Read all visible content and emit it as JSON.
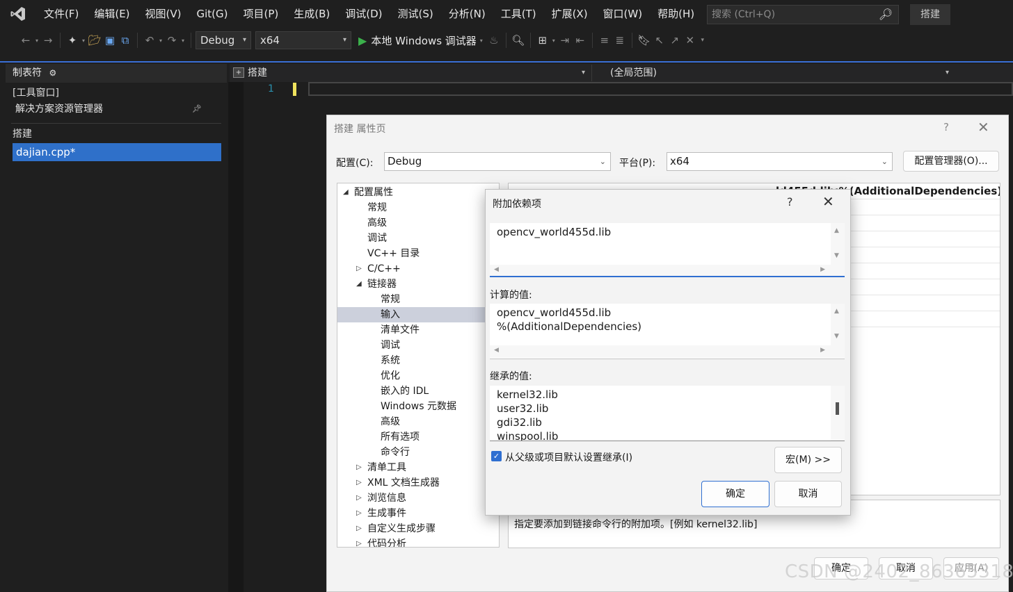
{
  "menubar": {
    "items": [
      "文件(F)",
      "编辑(E)",
      "视图(V)",
      "Git(G)",
      "项目(P)",
      "生成(B)",
      "调试(D)",
      "测试(S)",
      "分析(N)",
      "工具(T)",
      "扩展(X)",
      "窗口(W)",
      "帮助(H)"
    ],
    "search_placeholder": "搜索 (Ctrl+Q)",
    "solution_name": "搭建"
  },
  "toolbar": {
    "config": "Debug",
    "platform": "x64",
    "run_label": "本地 Windows 调试器"
  },
  "left_panel": {
    "title": "制表符",
    "group_label": "[工具窗口]",
    "solution_explorer": "解决方案资源管理器",
    "project_label": "搭建",
    "open_file": "dajian.cpp*"
  },
  "editor": {
    "file_scope": "搭建",
    "scope": "(全局范围)",
    "line_number": "1"
  },
  "prop_dialog": {
    "title": "搭建 属性页",
    "help": "?",
    "config_label": "配置(C):",
    "config_value": "Debug",
    "platform_label": "平台(P):",
    "platform_value": "x64",
    "config_manager": "配置管理器(O)...",
    "tree": [
      {
        "label": "配置属性",
        "level": 0,
        "expander": "◢"
      },
      {
        "label": "常规",
        "level": 1,
        "expander": ""
      },
      {
        "label": "高级",
        "level": 1,
        "expander": ""
      },
      {
        "label": "调试",
        "level": 1,
        "expander": ""
      },
      {
        "label": "VC++ 目录",
        "level": 1,
        "expander": ""
      },
      {
        "label": "C/C++",
        "level": 1,
        "expander": "▷"
      },
      {
        "label": "链接器",
        "level": 1,
        "expander": "◢"
      },
      {
        "label": "常规",
        "level": 2,
        "expander": ""
      },
      {
        "label": "输入",
        "level": 2,
        "expander": "",
        "selected": true
      },
      {
        "label": "清单文件",
        "level": 2,
        "expander": ""
      },
      {
        "label": "调试",
        "level": 2,
        "expander": ""
      },
      {
        "label": "系统",
        "level": 2,
        "expander": ""
      },
      {
        "label": "优化",
        "level": 2,
        "expander": ""
      },
      {
        "label": "嵌入的 IDL",
        "level": 2,
        "expander": ""
      },
      {
        "label": "Windows 元数据",
        "level": 2,
        "expander": ""
      },
      {
        "label": "高级",
        "level": 2,
        "expander": ""
      },
      {
        "label": "所有选项",
        "level": 2,
        "expander": ""
      },
      {
        "label": "命令行",
        "level": 2,
        "expander": ""
      },
      {
        "label": "清单工具",
        "level": 1,
        "expander": "▷"
      },
      {
        "label": "XML 文档生成器",
        "level": 1,
        "expander": "▷"
      },
      {
        "label": "浏览信息",
        "level": 1,
        "expander": "▷"
      },
      {
        "label": "生成事件",
        "level": 1,
        "expander": "▷"
      },
      {
        "label": "自定义生成步骤",
        "level": 1,
        "expander": "▷"
      },
      {
        "label": "代码分析",
        "level": 1,
        "expander": "▷"
      }
    ],
    "grid_header_value": "ld455d.lib;%(AdditionalDependencies)",
    "description": "指定要添加到链接命令行的附加项。[例如 kernel32.lib]",
    "ok": "确定",
    "cancel": "取消",
    "apply": "应用(A)"
  },
  "deps_dialog": {
    "title": "附加依赖项",
    "help": "?",
    "input_lines": [
      "opencv_world455d.lib"
    ],
    "computed_label": "计算的值:",
    "computed_lines": [
      "opencv_world455d.lib",
      "%(AdditionalDependencies)"
    ],
    "inherited_label": "继承的值:",
    "inherited_lines": [
      "kernel32.lib",
      "user32.lib",
      "gdi32.lib",
      "winspool.lib"
    ],
    "inherit_checkbox": "从父级或项目默认设置继承(I)",
    "inherit_checked": true,
    "macros": "宏(M) >>",
    "ok": "确定",
    "cancel": "取消"
  },
  "watermark": "CSDN @2402_86365318",
  "colors": {
    "accent": "#3a6fd6",
    "selection": "#2f70c9",
    "run_green": "#3bb04b",
    "tree_selected": "#ccd0dc"
  }
}
